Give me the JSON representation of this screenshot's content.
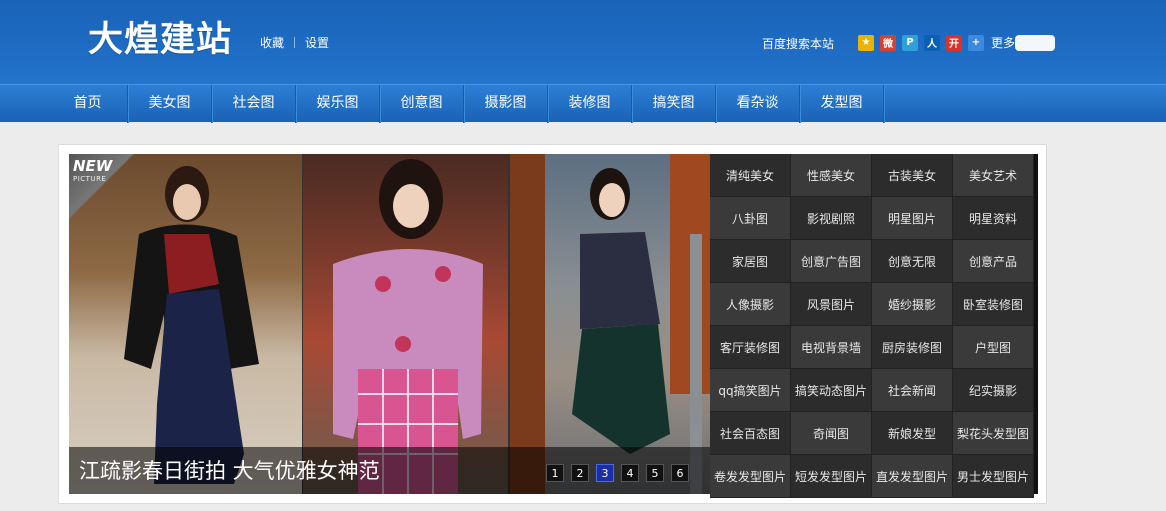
{
  "header": {
    "logo": "大煌建站",
    "links": [
      "收藏",
      "设置"
    ],
    "baidu_search": "百度搜索本站",
    "share_icons": [
      {
        "name": "qzone-icon",
        "color": "#e9b300",
        "glyph": "★"
      },
      {
        "name": "weibo-icon",
        "color": "#d6422e",
        "glyph": "微"
      },
      {
        "name": "tencent-weibo-icon",
        "color": "#2fa0d8",
        "glyph": "P"
      },
      {
        "name": "renren-icon",
        "color": "#0a5fb6",
        "glyph": "人"
      },
      {
        "name": "kaixin-icon",
        "color": "#d9322b",
        "glyph": "开"
      },
      {
        "name": "more-plus-icon",
        "color": "#3c8ae0",
        "glyph": "+"
      }
    ],
    "share_more": "更多"
  },
  "nav": {
    "items": [
      "首页",
      "美女图",
      "社会图",
      "娱乐图",
      "创意图",
      "摄影图",
      "装修图",
      "搞笑图",
      "看杂谈",
      "发型图"
    ]
  },
  "slider": {
    "badge_new": "NEW",
    "badge_sub": "PICTURE",
    "caption": "江疏影春日街拍 大气优雅女神范",
    "pages": [
      "1",
      "2",
      "3",
      "4",
      "5",
      "6"
    ],
    "active_page": "3"
  },
  "tags": [
    "清纯美女",
    "性感美女",
    "古装美女",
    "美女艺术",
    "八卦图",
    "影视剧照",
    "明星图片",
    "明星资料",
    "家居图",
    "创意广告图",
    "创意无限",
    "创意产品",
    "人像摄影",
    "风景图片",
    "婚纱摄影",
    "卧室装修图",
    "客厅装修图",
    "电视背景墙",
    "厨房装修图",
    "户型图",
    "qq搞笑图片",
    "搞笑动态图片",
    "社会新闻",
    "纪实摄影",
    "社会百态图",
    "奇闻图",
    "新娘发型",
    "梨花头发型图",
    "卷发发型图片",
    "短发发型图片",
    "直发发型图片",
    "男士发型图片"
  ],
  "colors": {
    "header_blue": "#1e6cc4",
    "nav_blue": "#2474cc",
    "active_page": "#1b2ea8"
  }
}
